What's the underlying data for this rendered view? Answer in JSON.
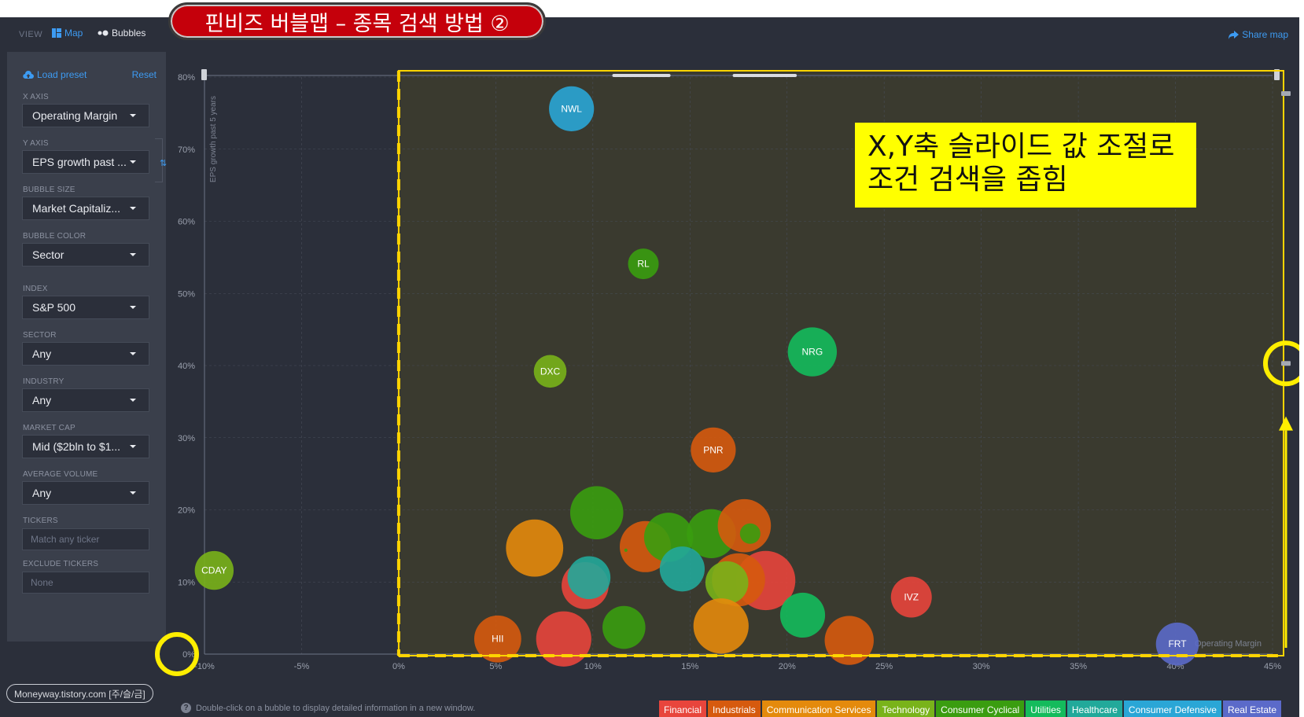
{
  "banner": "핀비즈 버블맵 – 종목 검색 방법 ②",
  "topbar": {
    "view_label": "VIEW",
    "map_label": "Map",
    "bubbles_label": "Bubbles",
    "share_label": "Share map"
  },
  "sidebar": {
    "load_preset": "Load preset",
    "reset": "Reset",
    "x_axis": {
      "label": "X AXIS",
      "value": "Operating Margin"
    },
    "y_axis": {
      "label": "Y AXIS",
      "value": "EPS growth past ..."
    },
    "bubble_size": {
      "label": "BUBBLE SIZE",
      "value": "Market Capitaliz..."
    },
    "bubble_color": {
      "label": "BUBBLE COLOR",
      "value": "Sector"
    },
    "index": {
      "label": "INDEX",
      "value": "S&P 500"
    },
    "sector": {
      "label": "SECTOR",
      "value": "Any"
    },
    "industry": {
      "label": "INDUSTRY",
      "value": "Any"
    },
    "market_cap": {
      "label": "MARKET CAP",
      "value": "Mid ($2bln to $1..."
    },
    "average_volume": {
      "label": "AVERAGE VOLUME",
      "value": "Any"
    },
    "tickers": {
      "label": "TICKERS",
      "placeholder": "Match any ticker"
    },
    "exclude_tickers": {
      "label": "EXCLUDE TICKERS",
      "placeholder": "None"
    }
  },
  "annotation": {
    "line1": "X,Y축 슬라이드 값 조절로",
    "line2": "조건 검색을 좁힘"
  },
  "credit": "Moneyway.tistory.com [주/슬/금]",
  "hint": "Double-click on a bubble to display detailed information in a new window.",
  "colors": {
    "background": "#2b2f3a",
    "accent": "#3d9bf2",
    "highlight": "#ffd400"
  },
  "legend": [
    {
      "label": "Financial",
      "color": "#e8453c"
    },
    {
      "label": "Industrials",
      "color": "#d65a0e"
    },
    {
      "label": "Communication Services",
      "color": "#e48a0c"
    },
    {
      "label": "Technology",
      "color": "#79b31a"
    },
    {
      "label": "Consumer Cyclical",
      "color": "#3a9d10"
    },
    {
      "label": "Utilities",
      "color": "#14bb5c"
    },
    {
      "label": "Healthcare",
      "color": "#22a99a"
    },
    {
      "label": "Consumer Defensive",
      "color": "#2aa6d6"
    },
    {
      "label": "Real Estate",
      "color": "#5b6ac9"
    }
  ],
  "chart_data": {
    "type": "scatter",
    "xlabel": "Operating Margin",
    "ylabel": "EPS growth past 5 years",
    "xlim": [
      -10,
      45
    ],
    "ylim": [
      0,
      80
    ],
    "x_ticks": [
      "-10%",
      "-5%",
      "0%",
      "5%",
      "10%",
      "15%",
      "20%",
      "25%",
      "30%",
      "35%",
      "40%",
      "45%"
    ],
    "y_ticks": [
      "0%",
      "10%",
      "20%",
      "30%",
      "40%",
      "50%",
      "60%",
      "70%",
      "80%"
    ],
    "grid": true,
    "selection": {
      "x_range": [
        0,
        45
      ],
      "y_range": [
        0,
        80
      ]
    },
    "points": [
      {
        "label": "NWL",
        "x": 8.9,
        "y": 75.6,
        "size": 1.1,
        "sector": "Consumer Defensive"
      },
      {
        "label": "RL",
        "x": 12.6,
        "y": 54.1,
        "size": 0.75,
        "sector": "Consumer Cyclical"
      },
      {
        "label": "NRG",
        "x": 21.3,
        "y": 41.9,
        "size": 1.2,
        "sector": "Utilities"
      },
      {
        "label": "DXC",
        "x": 7.8,
        "y": 39.2,
        "size": 0.8,
        "sector": "Technology"
      },
      {
        "label": "PNR",
        "x": 16.2,
        "y": 28.3,
        "size": 1.1,
        "sector": "Industrials"
      },
      {
        "label": "CDAY",
        "x": -9.5,
        "y": 11.6,
        "size": 0.95,
        "sector": "Technology"
      },
      {
        "label": "IVZ",
        "x": 26.4,
        "y": 7.9,
        "size": 1.0,
        "sector": "Financial"
      },
      {
        "label": "FRT",
        "x": 40.1,
        "y": 1.4,
        "size": 1.05,
        "sector": "Real Estate"
      },
      {
        "label": "HII",
        "x": 5.1,
        "y": 2.1,
        "size": 1.15,
        "sector": "Industrials"
      },
      {
        "label": "",
        "x": 10.2,
        "y": 19.6,
        "size": 1.3,
        "sector": "Consumer Cyclical"
      },
      {
        "label": "",
        "x": 7.0,
        "y": 14.7,
        "size": 1.4,
        "sector": "Communication Services"
      },
      {
        "label": "",
        "x": 12.7,
        "y": 14.9,
        "size": 1.25,
        "sector": "Industrials"
      },
      {
        "label": "",
        "x": 13.9,
        "y": 16.2,
        "size": 1.2,
        "sector": "Consumer Cyclical"
      },
      {
        "label": "",
        "x": 16.1,
        "y": 16.7,
        "size": 1.2,
        "sector": "Consumer Cyclical"
      },
      {
        "label": "",
        "x": 17.8,
        "y": 17.8,
        "size": 1.3,
        "sector": "Industrials"
      },
      {
        "label": "",
        "x": 18.1,
        "y": 16.7,
        "size": 0.5,
        "sector": "Consumer Cyclical"
      },
      {
        "label": "",
        "x": 9.6,
        "y": 9.5,
        "size": 1.15,
        "sector": "Financial"
      },
      {
        "label": "",
        "x": 9.8,
        "y": 10.6,
        "size": 1.05,
        "sector": "Healthcare"
      },
      {
        "label": "",
        "x": 14.6,
        "y": 11.8,
        "size": 1.1,
        "sector": "Healthcare"
      },
      {
        "label": "",
        "x": 18.9,
        "y": 10.2,
        "size": 1.45,
        "sector": "Financial"
      },
      {
        "label": "",
        "x": 17.5,
        "y": 10.3,
        "size": 1.3,
        "sector": "Industrials"
      },
      {
        "label": "",
        "x": 16.9,
        "y": 9.9,
        "size": 1.05,
        "sector": "Technology"
      },
      {
        "label": "",
        "x": 11.6,
        "y": 3.7,
        "size": 1.05,
        "sector": "Consumer Cyclical"
      },
      {
        "label": "",
        "x": 16.6,
        "y": 3.9,
        "size": 1.35,
        "sector": "Communication Services"
      },
      {
        "label": "",
        "x": 8.5,
        "y": 2.1,
        "size": 1.35,
        "sector": "Financial"
      },
      {
        "label": "",
        "x": 20.8,
        "y": 5.4,
        "size": 1.1,
        "sector": "Utilities"
      },
      {
        "label": "",
        "x": 23.2,
        "y": 1.9,
        "size": 1.2,
        "sector": "Industrials"
      },
      {
        "label": "",
        "x": 11.7,
        "y": 14.4,
        "size": 0.08,
        "sector": "Consumer Cyclical"
      }
    ]
  }
}
